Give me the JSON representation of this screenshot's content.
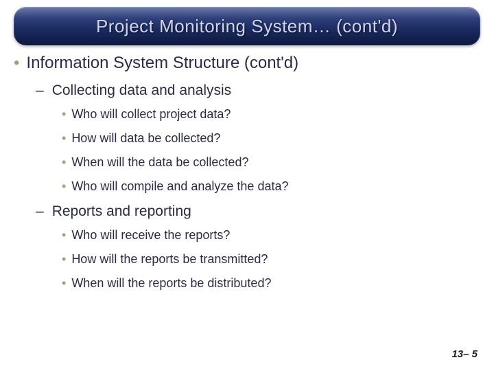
{
  "title": "Project Monitoring System… (cont'd)",
  "level1": {
    "text": "Information System Structure (cont'd)"
  },
  "sections": [
    {
      "heading": "Collecting data and analysis",
      "items": [
        "Who will collect project data?",
        "How will data be collected?",
        "When will the data be collected?",
        "Who will compile and analyze the data?"
      ]
    },
    {
      "heading": "Reports and reporting",
      "items": [
        "Who will receive the reports?",
        "How will the reports be transmitted?",
        "When will the reports be distributed?"
      ]
    }
  ],
  "page": "13– 5",
  "bullets": {
    "l1": "•",
    "l2": "–",
    "l3": "•"
  }
}
